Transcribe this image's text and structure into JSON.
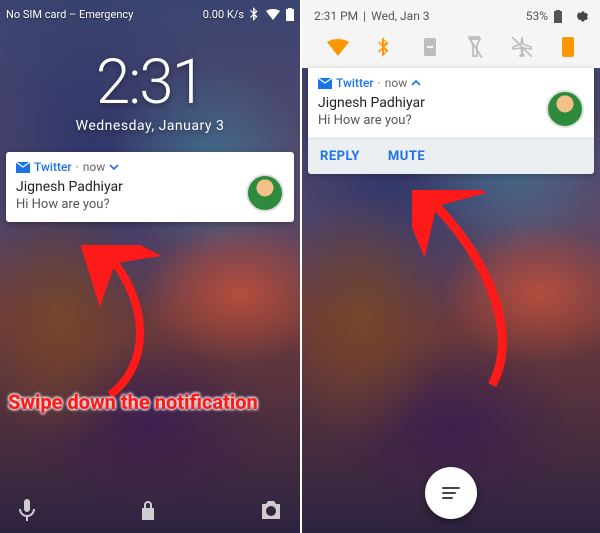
{
  "left": {
    "statusbar": {
      "carrier": "No SIM card – Emergency",
      "speed": "0.00 K/s"
    },
    "clock": {
      "time": "2:31",
      "date": "Wednesday, January 3"
    },
    "notification": {
      "app": "Twitter",
      "dot": "·",
      "when": "now",
      "sender": "Jignesh Padhiyar",
      "message": "Hi How are you?"
    },
    "annotation": "Swipe down the notification"
  },
  "right": {
    "shade": {
      "time": "2:31 PM",
      "sep": "|",
      "date": "Wed, Jan 3",
      "battery": "53%"
    },
    "notification": {
      "app": "Twitter",
      "dot": "·",
      "when": "now",
      "sender": "Jignesh Padhiyar",
      "message": "Hi How are you?"
    },
    "actions": {
      "reply": "REPLY",
      "mute": "MUTE"
    }
  }
}
